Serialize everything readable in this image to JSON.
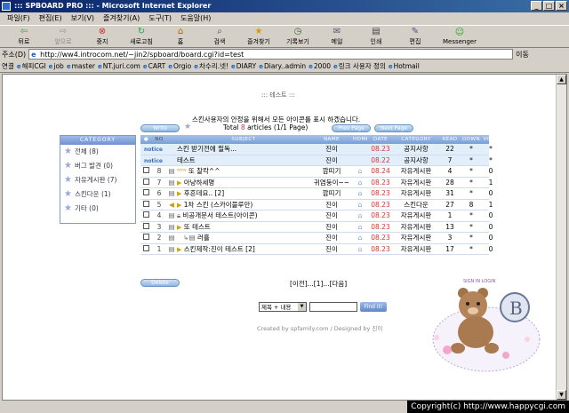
{
  "window": {
    "title": "::: SPBOARD PRO ::: - Microsoft Internet Explorer"
  },
  "menu": [
    "파일(F)",
    "편집(E)",
    "보기(V)",
    "즐겨찾기(A)",
    "도구(T)",
    "도움말(H)"
  ],
  "toolbar": [
    {
      "label": "뒤로",
      "icon": "back-arrow-icon"
    },
    {
      "label": "앞으로",
      "icon": "forward-arrow-icon"
    },
    {
      "label": "중지",
      "icon": "stop-icon"
    },
    {
      "label": "새로고침",
      "icon": "refresh-icon"
    },
    {
      "label": "홈",
      "icon": "home-icon"
    },
    {
      "label": "검색",
      "icon": "search-icon"
    },
    {
      "label": "즐겨찾기",
      "icon": "favorites-icon"
    },
    {
      "label": "기록보기",
      "icon": "history-icon"
    },
    {
      "label": "메일",
      "icon": "mail-icon"
    },
    {
      "label": "인쇄",
      "icon": "print-icon"
    },
    {
      "label": "편집",
      "icon": "edit-icon"
    },
    {
      "label": "Messenger",
      "icon": "messenger-icon"
    }
  ],
  "address": {
    "label": "주소(D)",
    "url": "http://ww4.introcom.net/~jin2/spboard/board.cgi?id=test",
    "go": "이동"
  },
  "links": {
    "label": "연결",
    "items": [
      "해피CGI",
      "job",
      "master",
      "NT.juri.com",
      "CART",
      "Orgio",
      "차수리.넷!",
      "DIARY",
      "Diary..admin",
      "2000",
      "링크 사용자 정의",
      "Hotmail"
    ]
  },
  "page": {
    "title": "::: 테스트 :::",
    "notice": "스킨사용자의 안정을 위해서 모든 아이콘를 표시 하겠습니다.",
    "total_prefix": "Total ",
    "total_count": "8",
    "total_suffix": " articles (1/1 Page)",
    "buttons": {
      "write": "Write",
      "prev_page": "Prev Page",
      "next_page": "Next Page",
      "delete": "Delete"
    }
  },
  "category": {
    "header": "CATEGORY",
    "items": [
      "전체 (8)",
      "버그 발견 (0)",
      "자유게시판 (7)",
      "스킨다운 (1)",
      "기타 (0)"
    ]
  },
  "board": {
    "headers": [
      "NO",
      "",
      "SUBJECT",
      "NAME",
      "HOME",
      "DATE",
      "CATEGORY",
      "READ",
      "DOWN",
      "VOTE"
    ],
    "rows": [
      {
        "no": "notice",
        "subject": "스킨 받기전에 필독...",
        "name": "진이",
        "date": "08.23",
        "cat": "공지사항",
        "read": "22",
        "down": "*",
        "vote": "*",
        "notice": true
      },
      {
        "no": "notice",
        "subject": "테스트",
        "name": "진이",
        "date": "08.22",
        "cat": "공지사항",
        "read": "7",
        "down": "*",
        "vote": "*",
        "notice": true
      },
      {
        "no": "8",
        "subject": "또 찰칵^^",
        "name": "깜띠기",
        "date": "08.24",
        "cat": "자유게시판",
        "read": "4",
        "down": "*",
        "vote": "0"
      },
      {
        "no": "7",
        "subject": "아냥하세명",
        "name": "귀염둥이~~",
        "date": "08.23",
        "cat": "자유게시판",
        "read": "28",
        "down": "*",
        "vote": "1"
      },
      {
        "no": "6",
        "subject": "후흔데요..  [2]",
        "name": "깜띠기",
        "date": "08.23",
        "cat": "자유게시판",
        "read": "31",
        "down": "*",
        "vote": "0"
      },
      {
        "no": "5",
        "subject": "1차 스킨 (스카이블루만)",
        "name": "진이",
        "date": "08.23",
        "cat": "스킨다운",
        "read": "27",
        "down": "8",
        "vote": "1"
      },
      {
        "no": "4",
        "subject": "비공개문서 테스트(아이콘)",
        "name": "진이",
        "date": "08.23",
        "cat": "자유게시판",
        "read": "1",
        "down": "*",
        "vote": "0"
      },
      {
        "no": "3",
        "subject": "또 테스트",
        "name": "진이",
        "date": "08.23",
        "cat": "자유게시판",
        "read": "13",
        "down": "*",
        "vote": "0"
      },
      {
        "no": "2",
        "subject": "러흘",
        "name": "진이",
        "date": "08.23",
        "cat": "자유게시판",
        "read": "3",
        "down": "*",
        "vote": "0"
      },
      {
        "no": "1",
        "subject": "스킨제작:진이 테스트  [2]",
        "name": "진이",
        "date": "08.23",
        "cat": "자유게시판",
        "read": "17",
        "down": "*",
        "vote": "0"
      }
    ]
  },
  "pager": "[이전]...[1]...[다음]",
  "search": {
    "select_value": "제목 + 내용",
    "button": "Find it!"
  },
  "credit": "Created by spfamily.com / Designed by 진이",
  "mascot": {
    "signin": "SIGN IN",
    "login": "LOGIN"
  },
  "copyright": "Copyright(c) http://www.happycgi.com"
}
